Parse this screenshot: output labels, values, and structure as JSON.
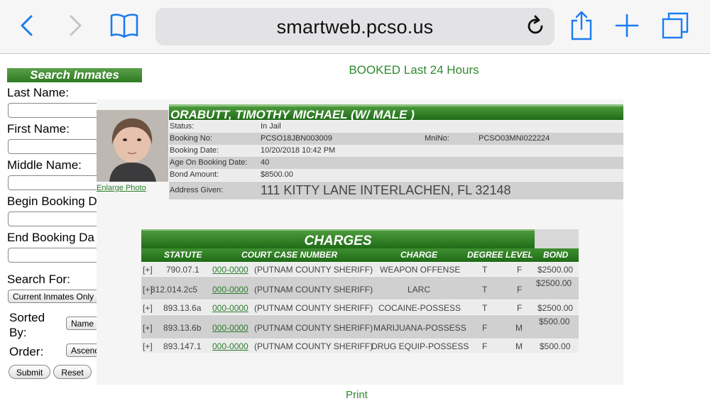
{
  "browser": {
    "url": "smartweb.pcso.us",
    "icons": [
      "back-chevron-icon",
      "forward-chevron-icon",
      "bookmarks-icon",
      "reload-icon",
      "share-icon",
      "new-tab-plus-icon",
      "tabs-icon"
    ]
  },
  "search": {
    "header": "Search Inmates",
    "last_name_label": "Last Name:",
    "first_name_label": "First Name:",
    "middle_name_label": "Middle Name:",
    "begin_booking_label": "Begin Booking D",
    "end_booking_label": "End Booking Da",
    "search_for_label": "Search For:",
    "search_for_value": "Current Inmates Only",
    "sorted_by_label": "Sorted By:",
    "sorted_by_value": "Name",
    "order_label": "Order:",
    "order_value": "Ascend",
    "submit_label": "Submit",
    "reset_label": "Reset"
  },
  "page": {
    "booked_title": "BOOKED Last 24 Hours",
    "enlarge_photo": "Enlarge Photo",
    "print": "Print"
  },
  "inmate": {
    "name_line": "ORABUTT, TIMOTHY MICHAEL   (W/ MALE )",
    "status_label": "Status:",
    "status": "In Jail",
    "booking_no_label": "Booking No:",
    "booking_no": "PCSO18JBN003009",
    "mnino_label": "MniNo:",
    "mnino": "PCSO03MNI022224",
    "booking_date_label": "Booking Date:",
    "booking_date": "10/20/2018 10:42 PM",
    "age_label": "Age On Booking Date:",
    "age": "40",
    "bond_label": "Bond Amount:",
    "bond": "$8500.00",
    "address_label": "Address Given:",
    "address": "111 KITTY LANE INTERLACHEN, FL 32148"
  },
  "charges": {
    "title": "CHARGES",
    "headers": {
      "statute": "STATUTE",
      "case": "COURT CASE NUMBER",
      "charge": "CHARGE",
      "degree_level": "DEGREE LEVEL",
      "bond": "BOND"
    },
    "rows": [
      {
        "toggle": "[+]",
        "statute": "790.07.1",
        "case_link": "000-0000",
        "agency": "(PUTNAM COUNTY SHERIFF)",
        "charge": "WEAPON OFFENSE",
        "degree": "T",
        "level": "F",
        "bond": "$2500.00"
      },
      {
        "toggle": "[+]",
        "statute": "812.014.2c5",
        "case_link": "000-0000",
        "agency": "(PUTNAM COUNTY SHERIFF)",
        "charge": "LARC",
        "degree": "T",
        "level": "F",
        "bond": "$2500.00"
      },
      {
        "toggle": "[+]",
        "statute": "893.13.6a",
        "case_link": "000-0000",
        "agency": "(PUTNAM COUNTY SHERIFF)",
        "charge": "COCAINE-POSSESS",
        "degree": "T",
        "level": "F",
        "bond": "$2500.00"
      },
      {
        "toggle": "[+]",
        "statute": "893.13.6b",
        "case_link": "000-0000",
        "agency": "(PUTNAM COUNTY SHERIFF)",
        "charge": "MARIJUANA-POSSESS",
        "degree": "F",
        "level": "M",
        "bond": "$500.00"
      },
      {
        "toggle": "[+]",
        "statute": "893.147.1",
        "case_link": "000-0000",
        "agency": "(PUTNAM COUNTY SHERIFF)",
        "charge": "DRUG EQUIP-POSSESS",
        "degree": "F",
        "level": "M",
        "bond": "$500.00"
      }
    ]
  },
  "colors": {
    "accent_green": "#2e8b2e",
    "header_green": "#1f6b17",
    "browser_blue": "#1a7cf2"
  }
}
